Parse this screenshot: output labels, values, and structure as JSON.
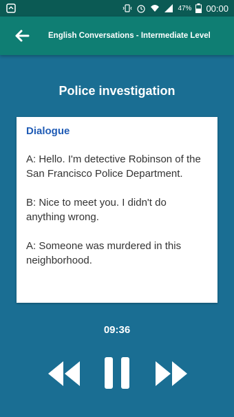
{
  "status_bar": {
    "battery": "47%",
    "time": "00:00"
  },
  "app_bar": {
    "title": "English Conversations - Intermediate Level"
  },
  "screen": {
    "title": "Police investigation"
  },
  "dialogue": {
    "header": "Dialogue",
    "lines": [
      "A: Hello. I'm detective Robinson of the San Francisco Police Department.",
      "B: Nice to meet you. I didn't do anything wrong.",
      "A: Someone was murdered in this neighborhood."
    ]
  },
  "player": {
    "time": "09:36"
  },
  "icons": {
    "status_left": "notification-icon",
    "back": "arrow-left-icon",
    "rewind": "rewind-icon",
    "pause": "pause-icon",
    "forward": "fast-forward-icon"
  },
  "colors": {
    "background": "#1a6e93",
    "app_bar": "#0f7e73",
    "status_bar": "#0b5a54",
    "dialogue_header": "#1f5bb5"
  }
}
